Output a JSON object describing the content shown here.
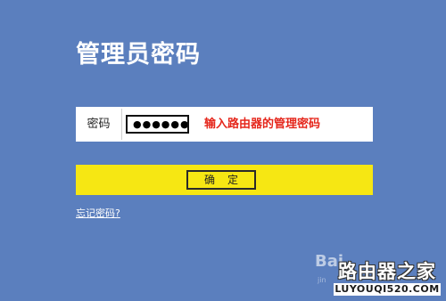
{
  "header": {
    "title": "管理员密码"
  },
  "password": {
    "label": "密码",
    "value": "●●●●●●",
    "hint": "输入路由器的管理密码"
  },
  "actions": {
    "confirm_label": "确定",
    "forgot_label": "忘记密码?"
  },
  "watermarks": {
    "baidu": "Bai",
    "baidu_sub": "jin",
    "logo_top": "路由器之家",
    "logo_bottom": "LUYOUQI520.COM"
  },
  "colors": {
    "background": "#5b7fbe",
    "confirm_bar": "#f6e713",
    "hint": "#e5261b"
  }
}
